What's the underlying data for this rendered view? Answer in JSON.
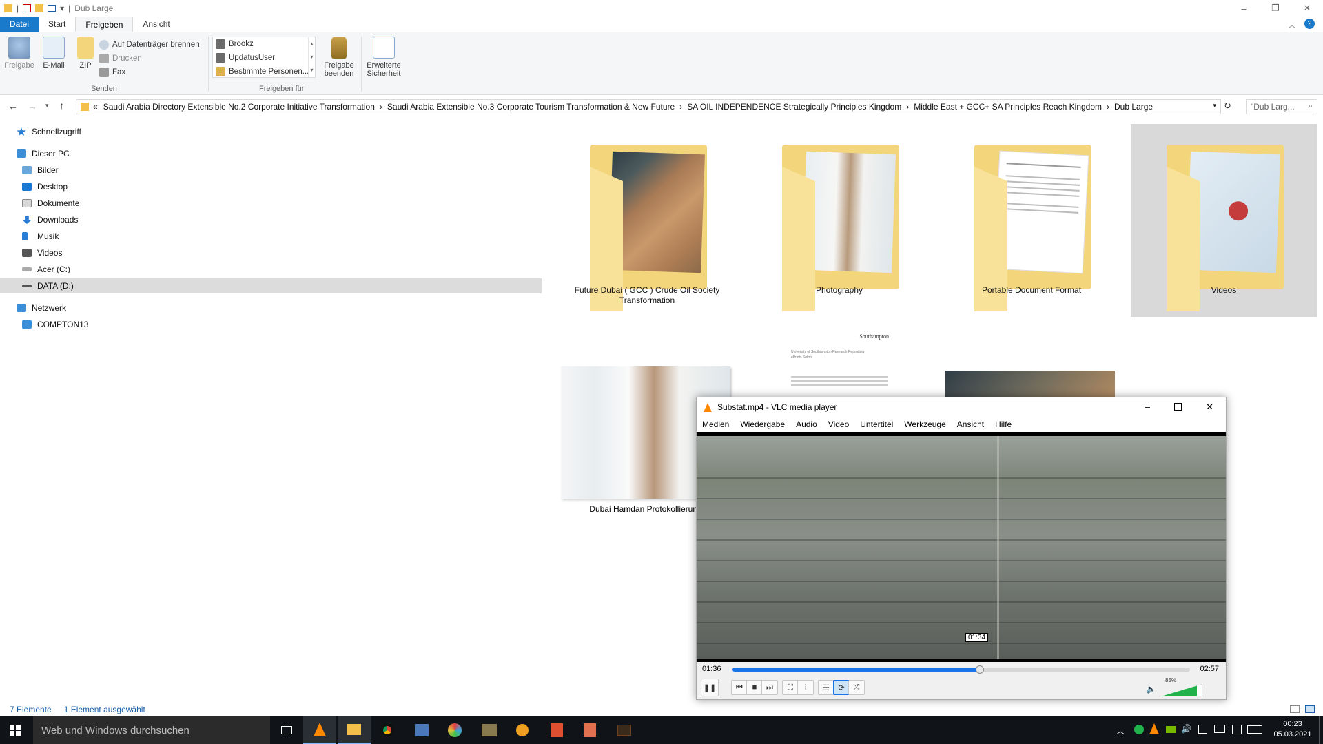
{
  "window": {
    "title": "Dub Large",
    "controls": {
      "minimize": "–",
      "maximize": "❐",
      "close": "✕"
    }
  },
  "tabs": [
    "Datei",
    "Start",
    "Freigeben",
    "Ansicht"
  ],
  "ribbon": {
    "send": {
      "share": "Freigabe",
      "email": "E-Mail",
      "zip": "ZIP",
      "burn": "Auf Datenträger brennen",
      "print": "Drucken",
      "fax": "Fax",
      "label": "Senden"
    },
    "share_with": {
      "users": [
        "Brookz",
        "UpdatusUser",
        "Bestimmte Personen..."
      ],
      "label": "Freigeben für"
    },
    "stop_sharing": {
      "line1": "Freigabe",
      "line2": "beenden"
    },
    "advanced": {
      "line1": "Erweiterte",
      "line2": "Sicherheit"
    }
  },
  "address": {
    "chevron": "«",
    "path": [
      "Saudi Arabia Directory Extensible No.2  Corporate Initiative Transformation",
      "Saudi Arabia Extensible No.3 Corporate Tourism Transformation & New Future",
      "SA OIL INDEPENDENCE Strategically Principles  Kingdom",
      "Middle East + GCC+ SA Principles Reach Kingdom",
      "Dub Large"
    ],
    "separator": "›",
    "search_placeholder": "\"Dub Larg..."
  },
  "nav": {
    "quick_access": "Schnellzugriff",
    "this_pc": "Dieser PC",
    "items": [
      "Bilder",
      "Desktop",
      "Dokumente",
      "Downloads",
      "Musik",
      "Videos",
      "Acer (C:)",
      "DATA (D:)"
    ],
    "network": "Netzwerk",
    "network_items": [
      "COMPTON13"
    ]
  },
  "folders": [
    {
      "label": "Future Dubai ( GCC ) Crude Oil Society Transformation"
    },
    {
      "label": "Photography"
    },
    {
      "label": "Portable Document Format"
    },
    {
      "label": "Videos"
    }
  ],
  "files": [
    {
      "label": "Dubai Hamdan Protokollierung"
    }
  ],
  "document_preview": {
    "logo": "Southampton",
    "line1": "University of Southampton Research Repository",
    "line2": "ePrints Soton"
  },
  "status": {
    "count": "7 Elemente",
    "selected": "1 Element ausgewählt"
  },
  "vlc": {
    "title": "Substat.mp4 - VLC media player",
    "menu": [
      "Medien",
      "Wiedergabe",
      "Audio",
      "Video",
      "Untertitel",
      "Werkzeuge",
      "Ansicht",
      "Hilfe"
    ],
    "elapsed": "01:36",
    "total": "02:57",
    "tooltip": "01:34",
    "progress": 0.54,
    "volume": "85%",
    "volume_level": 0.85
  },
  "taskbar": {
    "search_placeholder": "Web und Windows durchsuchen",
    "time": "00:23",
    "date": "05.03.2021"
  },
  "colors": {
    "accent": "#1979ca",
    "folder": "#f8d775",
    "vlc_orange": "#ff8800",
    "taskbar": "#101418",
    "progress": "#1a73e8"
  }
}
